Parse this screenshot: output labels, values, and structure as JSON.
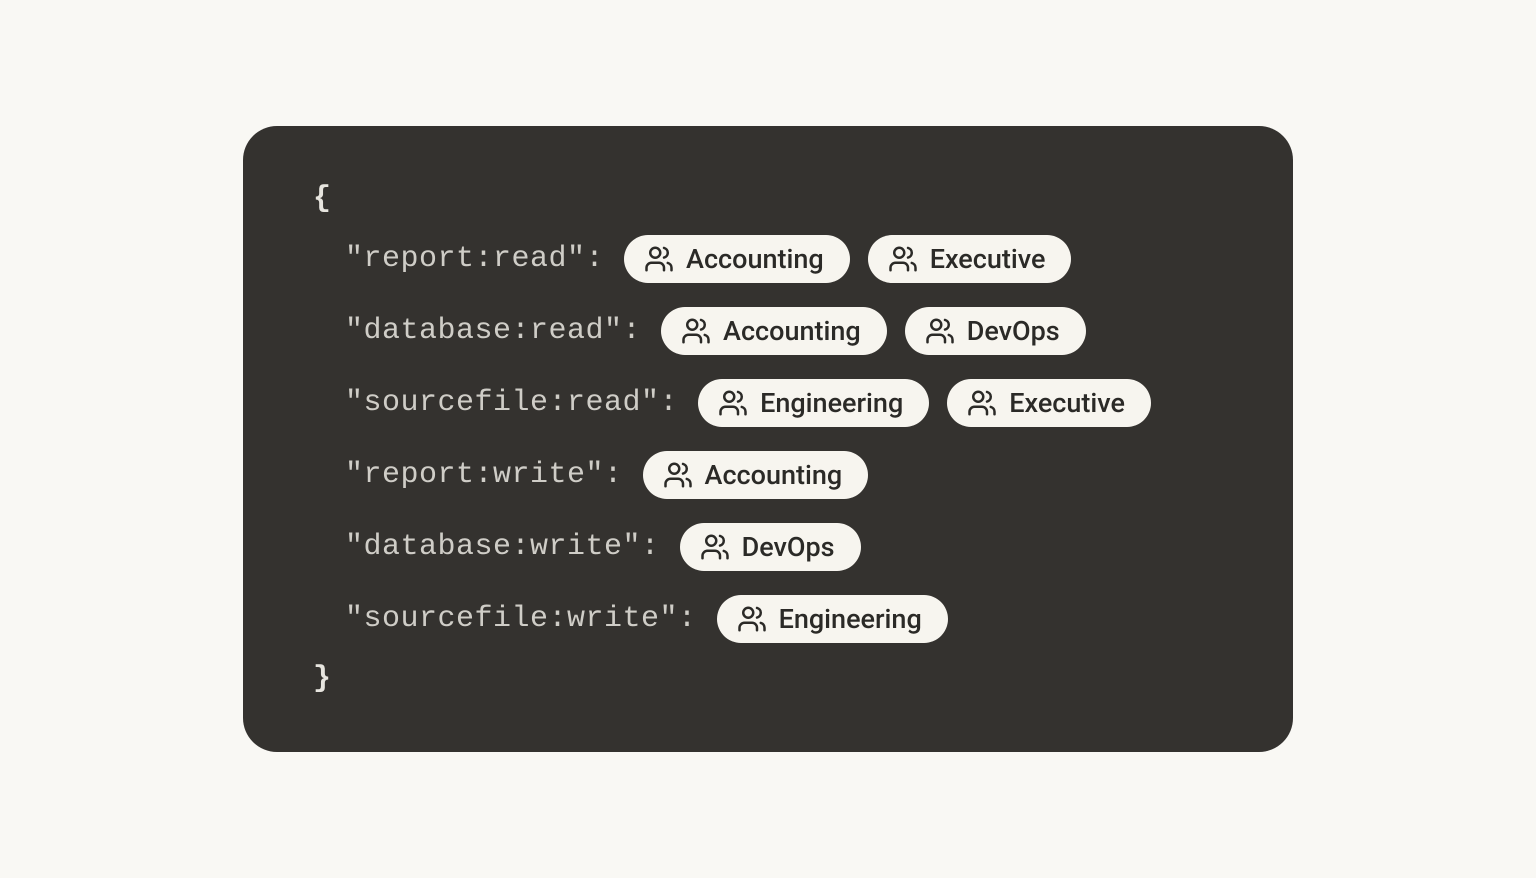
{
  "braces": {
    "open": "{",
    "close": "}"
  },
  "permissions": [
    {
      "key": "\"report:read\":",
      "groups": [
        "Accounting",
        "Executive"
      ]
    },
    {
      "key": "\"database:read\":",
      "groups": [
        "Accounting",
        "DevOps"
      ]
    },
    {
      "key": "\"sourcefile:read\":",
      "groups": [
        "Engineering",
        "Executive"
      ]
    },
    {
      "key": "\"report:write\":",
      "groups": [
        "Accounting"
      ]
    },
    {
      "key": "\"database:write\":",
      "groups": [
        "DevOps"
      ]
    },
    {
      "key": "\"sourcefile:write\":",
      "groups": [
        "Engineering"
      ]
    }
  ]
}
